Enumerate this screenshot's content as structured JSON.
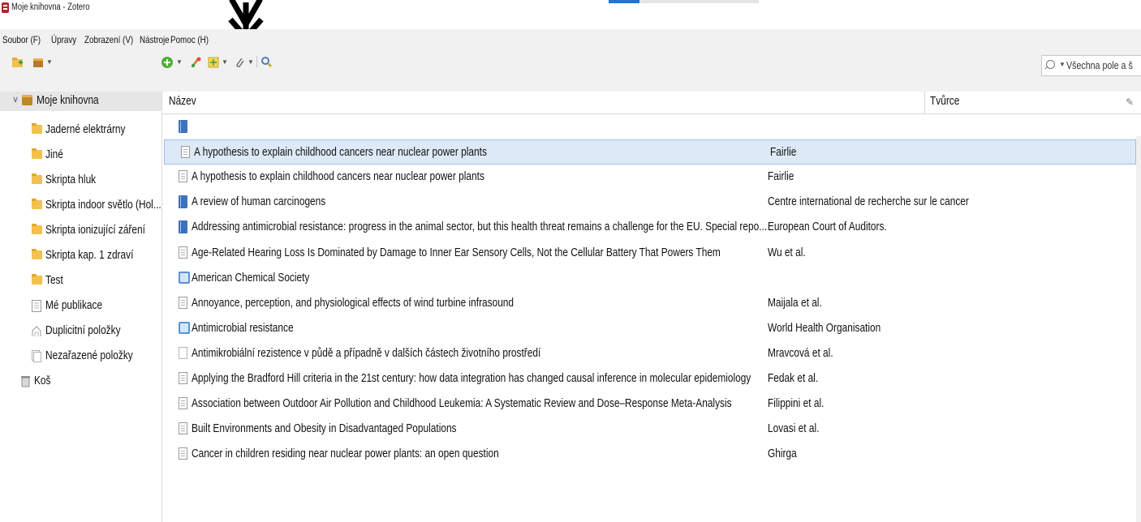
{
  "window": {
    "title": "Moje knihovna - Zotero"
  },
  "menubar": {
    "items": [
      {
        "label": "Soubor (F)"
      },
      {
        "label": "Úpravy"
      },
      {
        "label": "Zobrazení (V)"
      },
      {
        "label": "Nástroje"
      },
      {
        "label": "Pomoc (H)"
      }
    ]
  },
  "toolbar": {
    "left": [
      "new-collection-icon",
      "new-library-icon"
    ],
    "main": [
      "new-item-icon",
      "add-by-identifier-icon",
      "new-note-icon",
      "add-attachment-icon",
      "advanced-search-icon"
    ]
  },
  "search": {
    "mode": "Všechna pole a š"
  },
  "sidebar": {
    "library": "Moje knihovna",
    "collections": [
      {
        "label": "Jaderné elektrárny",
        "icon": "folder-icon"
      },
      {
        "label": "Jiné",
        "icon": "folder-icon"
      },
      {
        "label": "Skripta hluk",
        "icon": "folder-icon"
      },
      {
        "label": "Skripta indoor světlo (Hol...",
        "icon": "folder-icon"
      },
      {
        "label": "Skripta ionizující záření",
        "icon": "folder-icon"
      },
      {
        "label": "Skripta kap. 1 zdraví",
        "icon": "folder-icon"
      },
      {
        "label": "Test",
        "icon": "folder-icon"
      },
      {
        "label": "Mé publikace",
        "icon": "publications-icon"
      },
      {
        "label": "Duplicitní položky",
        "icon": "duplicates-icon"
      },
      {
        "label": "Nezařazené položky",
        "icon": "unfiled-icon"
      },
      {
        "label": "Koš",
        "icon": "trash-icon"
      }
    ]
  },
  "list": {
    "columns": {
      "title": "Název",
      "creator": "Tvůrce"
    },
    "rows": [
      {
        "type": "book",
        "title": "",
        "creator": ""
      },
      {
        "type": "doc",
        "title": "A hypothesis to explain childhood cancers near nuclear power plants",
        "creator": "Fairlie",
        "selected": true
      },
      {
        "type": "doc",
        "title": "A hypothesis to explain childhood cancers near nuclear power plants",
        "creator": "Fairlie"
      },
      {
        "type": "book",
        "title": "A review of human carcinogens",
        "creator": "Centre international de recherche sur le cancer"
      },
      {
        "type": "book",
        "title": "Addressing antimicrobial resistance: progress in the animal sector, but this health threat remains a challenge for the EU. Special repo...",
        "creator": "European Court of Auditors."
      },
      {
        "type": "doc",
        "title": "Age-Related Hearing Loss Is Dominated by Damage to Inner Ear Sensory Cells, Not the Cellular Battery That Powers Them",
        "creator": "Wu et al."
      },
      {
        "type": "web",
        "title": "American Chemical Society",
        "creator": ""
      },
      {
        "type": "doc",
        "title": "Annoyance, perception, and physiological effects of wind turbine infrasound",
        "creator": "Maijala et al."
      },
      {
        "type": "web",
        "title": "Antimicrobial resistance",
        "creator": "World Health Organisation"
      },
      {
        "type": "blank",
        "title": "Antimikrobiální rezistence v půdě a případně v dalších částech životního prostředí",
        "creator": "Mravcová et al."
      },
      {
        "type": "doc",
        "title": "Applying the Bradford Hill criteria in the 21st century: how data integration has changed causal inference in molecular epidemiology",
        "creator": "Fedak et al."
      },
      {
        "type": "doc",
        "title": "Association between Outdoor Air Pollution and Childhood Leukemia: A Systematic Review and Dose–Response Meta-Analysis",
        "creator": "Filippini et al."
      },
      {
        "type": "doc",
        "title": "Built Environments and Obesity in Disadvantaged Populations",
        "creator": "Lovasi et al."
      },
      {
        "type": "doc",
        "title": "Cancer in children residing near nuclear power plants: an open question",
        "creator": "Ghirga"
      }
    ]
  },
  "colors": {
    "selection": "#dde9f7",
    "folder": "#f2c14e",
    "annotation_arrow": "#000000"
  }
}
